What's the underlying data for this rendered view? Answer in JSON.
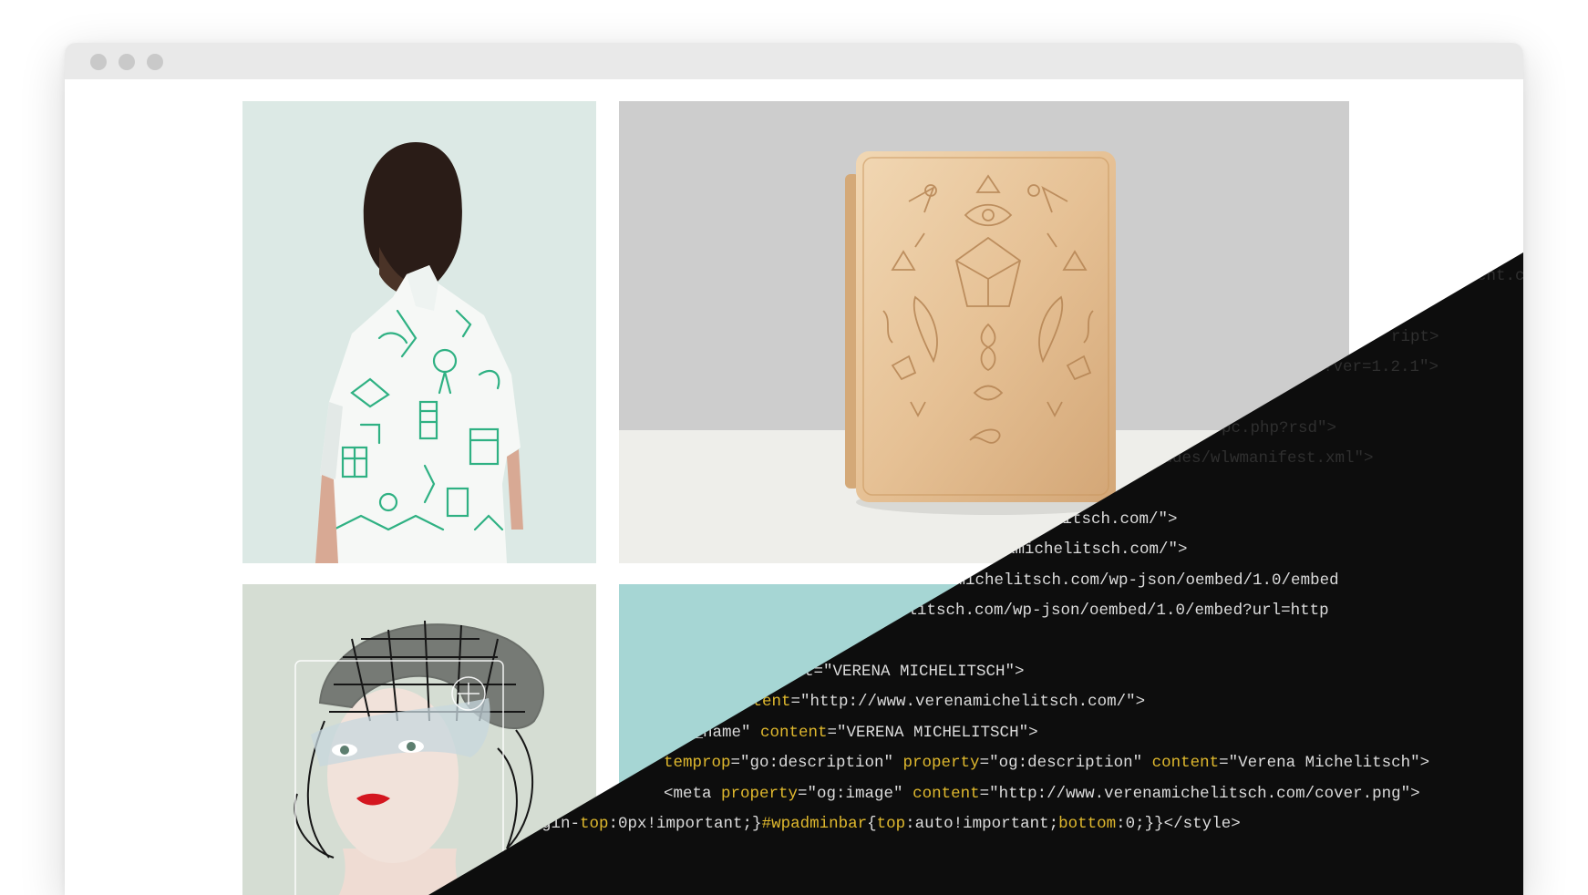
{
  "window": {
    "traffic_lights": [
      "close",
      "minimize",
      "zoom"
    ]
  },
  "gallery": {
    "tiles": [
      {
        "name": "photo-shirt",
        "subject": "shirt"
      },
      {
        "name": "photo-gold-case",
        "subject": "gold-case"
      },
      {
        "name": "photo-mask",
        "subject": "mask"
      },
      {
        "name": "photo-teal",
        "subject": "teal"
      }
    ]
  },
  "code_lines": [
    "ent.c",
    "ript>",
    "?ver=1.2.1\">",
    "pc.php?rsd\">",
    "ludes/wlwmanifest.xml\">",
    "litsch.com/\">",
    "amichelitsch.com/\">",
    "amichelitsch.com/wp-json/oembed/1.0/embed",
    "chelitsch.com/wp-json/oembed/1.0/embed?url=http",
    "t=\"VERENA MICHELITSCH\">",
    "ntent=\"http://www.verenamichelitsch.com/\">",
    "e_name\" content=\"VERENA MICHELITSCH\">",
    "temprop=\"go:description\" property=\"og:description\" content=\"Verena Michelitsch\">",
    "<meta property=\"og:image\" content=\"http://www.verenamichelitsch.com/cover.png\">",
    "gin-top:0px!important;}#wpadminbar{top:auto!important;bottom:0;}}</style>"
  ],
  "colors": {
    "code_background": "#0d0d0d",
    "code_text": "#dcdcdc",
    "code_attribute": "#e0b92e",
    "titlebar": "#e9e9e9",
    "traffic_light": "#c9c9c9"
  }
}
